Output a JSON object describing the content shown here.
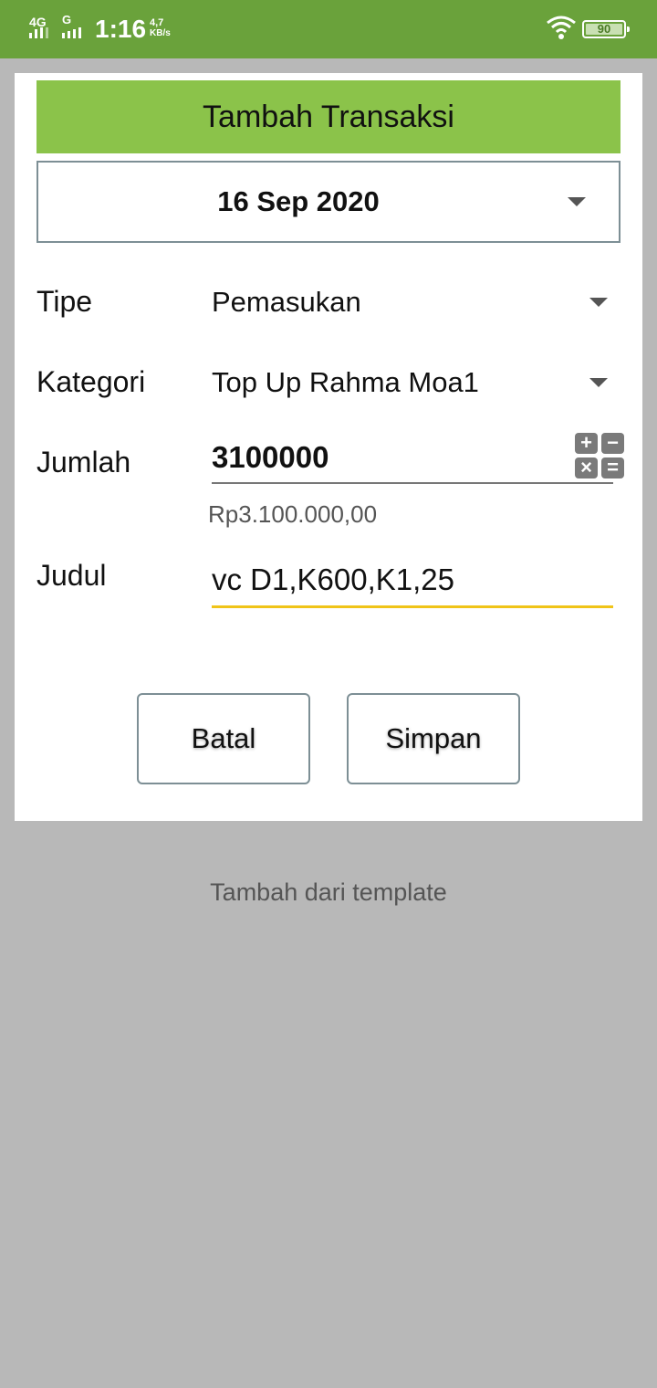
{
  "status_bar": {
    "network_1": "4G",
    "network_2": "G",
    "time": "1:16",
    "speed_value": "4,7",
    "speed_unit": "KB/s",
    "battery_level": "90",
    "icons": [
      "signal-icon",
      "signal-icon",
      "wifi-icon",
      "battery-icon"
    ]
  },
  "dialog": {
    "title": "Tambah Transaksi",
    "date": "16 Sep 2020",
    "fields": {
      "type_label": "Tipe",
      "type_value": "Pemasukan",
      "category_label": "Kategori",
      "category_value": "Top Up Rahma Moa1",
      "amount_label": "Jumlah",
      "amount_value": "3100000",
      "amount_formatted": "Rp3.100.000,00",
      "title_label": "Judul",
      "title_value": "vc D1,K600,K1,25"
    },
    "buttons": {
      "cancel": "Batal",
      "save": "Simpan"
    }
  },
  "template_link": "Tambah dari template",
  "colors": {
    "status_bar": "#6aa23b",
    "header": "#8bc34a",
    "focus_underline": "#f0c419",
    "backdrop": "#b8b8b8"
  }
}
